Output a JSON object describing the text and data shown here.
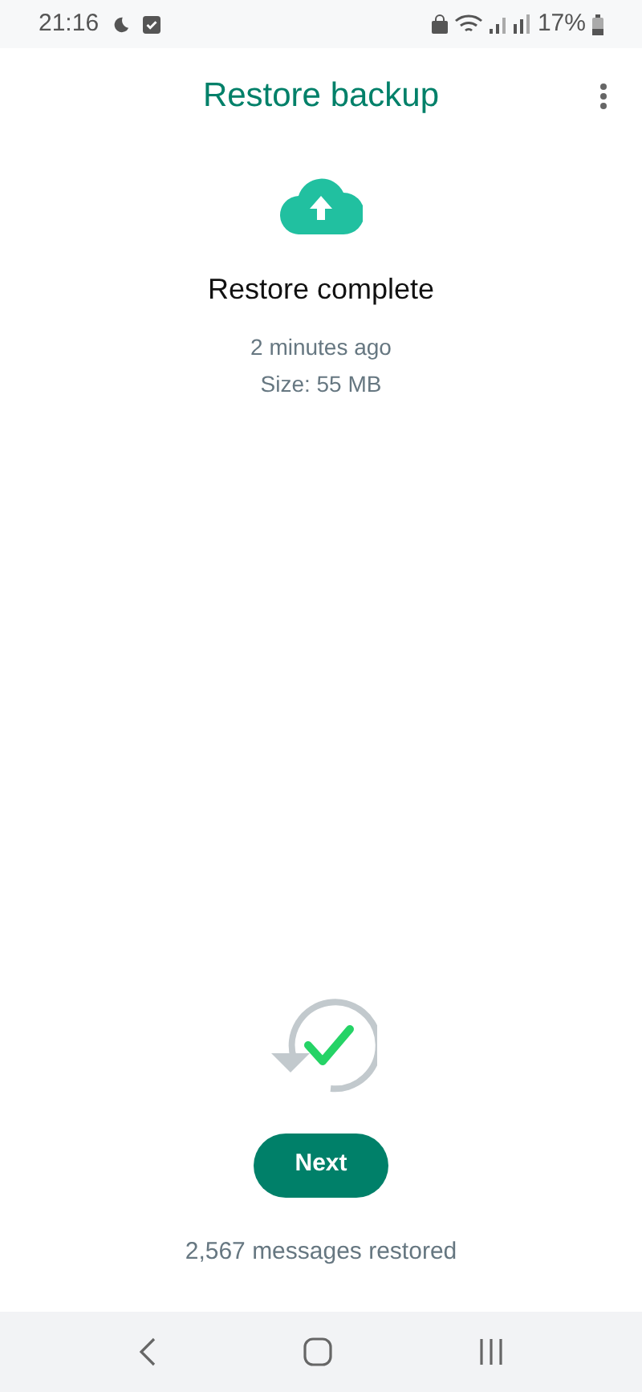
{
  "status_bar": {
    "time": "21:16",
    "battery": "17%"
  },
  "header": {
    "title": "Restore backup"
  },
  "backup": {
    "title": "Restore complete",
    "age": "2 minutes ago",
    "size": "Size: 55 MB"
  },
  "next_button": {
    "label": "Next"
  },
  "footer": {
    "message": "2,567 messages restored"
  }
}
